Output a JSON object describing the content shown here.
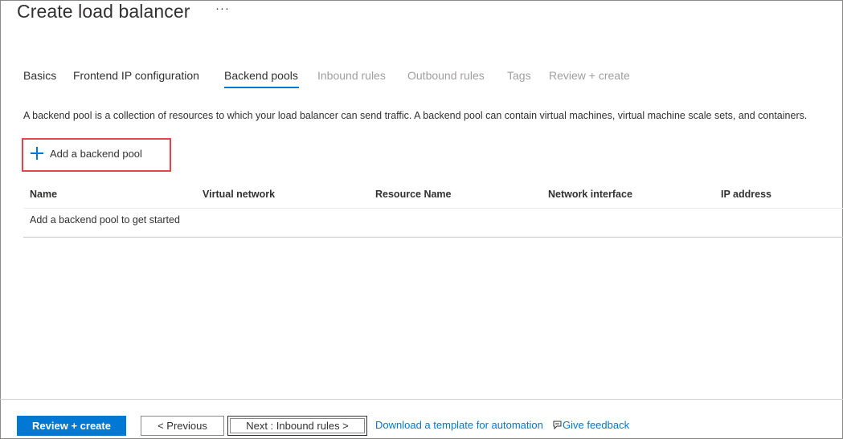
{
  "header": {
    "title": "Create load balancer",
    "more_label": "···"
  },
  "tabs": [
    {
      "label": "Basics",
      "state": "enabled"
    },
    {
      "label": "Frontend IP configuration",
      "state": "enabled"
    },
    {
      "label": "Backend pools",
      "state": "active"
    },
    {
      "label": "Inbound rules",
      "state": "disabled"
    },
    {
      "label": "Outbound rules",
      "state": "disabled"
    },
    {
      "label": "Tags",
      "state": "disabled"
    },
    {
      "label": "Review + create",
      "state": "disabled"
    }
  ],
  "main": {
    "description": "A backend pool is a collection of resources to which your load balancer can send traffic. A backend pool can contain virtual machines, virtual machine scale sets, and containers.",
    "add_button_label": "Add a backend pool",
    "add_button_icon": "plus-icon",
    "table": {
      "columns": [
        "Name",
        "Virtual network",
        "Resource Name",
        "Network interface",
        "IP address"
      ],
      "empty_message": "Add a backend pool to get started"
    }
  },
  "footer": {
    "review_create_label": "Review + create",
    "previous_label": "< Previous",
    "next_label": "Next : Inbound rules >",
    "download_template_label": "Download a template for automation",
    "feedback_label": "Give feedback",
    "feedback_icon": "feedback-icon"
  },
  "colors": {
    "accent": "#0078d4",
    "highlight_border": "#e8424a",
    "disabled_text": "#a19f9d"
  }
}
